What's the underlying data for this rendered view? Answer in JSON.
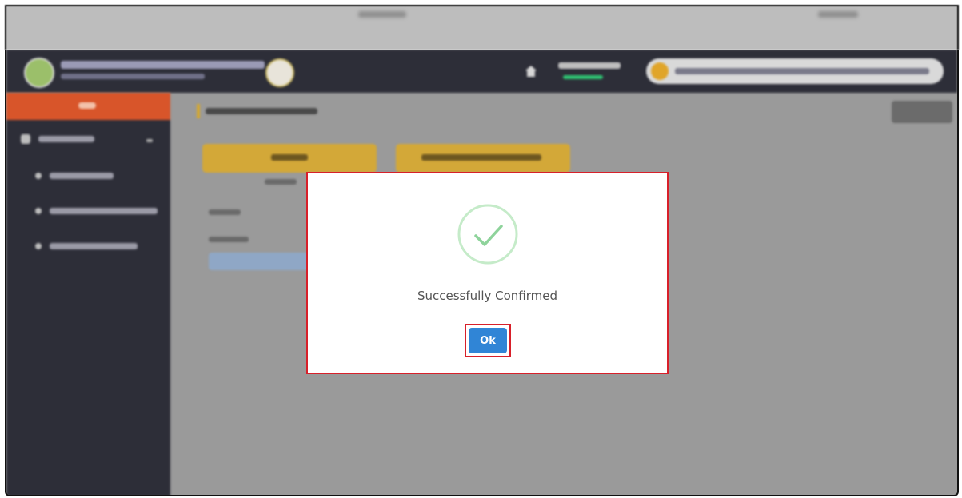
{
  "dialog": {
    "message": "Successfully Confirmed",
    "ok_label": "Ok",
    "icon": "success-check-icon",
    "ok_button_color": "#3085d6",
    "check_color": "#8ed39b",
    "highlight_color": "#d8202a"
  },
  "header": {
    "background_color": "#2d2e38",
    "timer_bar_color": "#2fbf71",
    "sidebar_accent_color": "#d8552a"
  }
}
